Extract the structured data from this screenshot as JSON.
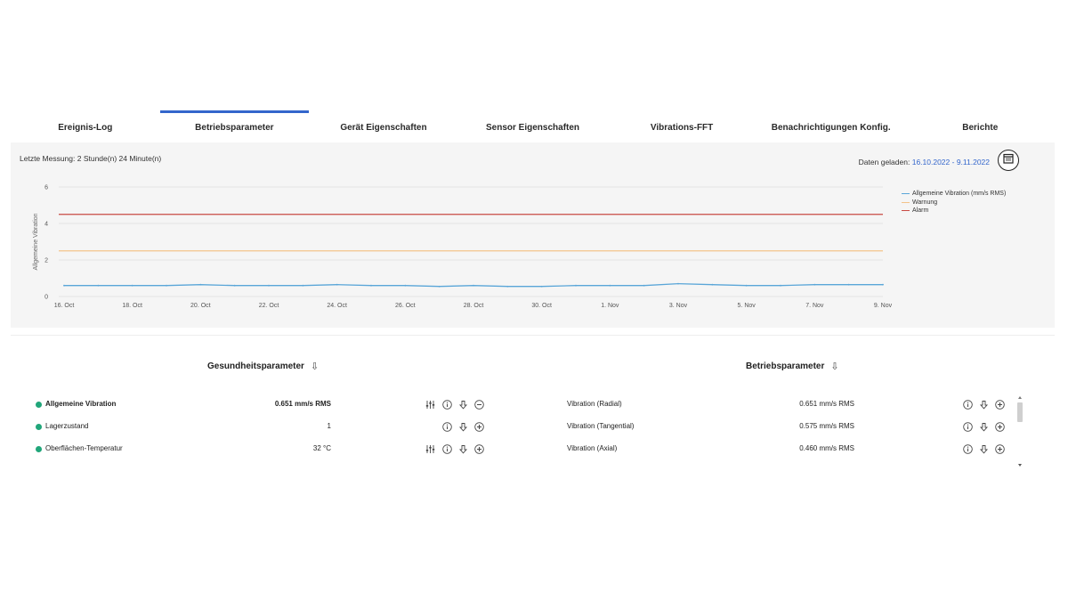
{
  "tabs": [
    {
      "label": "Ereignis-Log",
      "active": false
    },
    {
      "label": "Betriebsparameter",
      "active": true
    },
    {
      "label": "Gerät Eigenschaften",
      "active": false
    },
    {
      "label": "Sensor Eigenschaften",
      "active": false
    },
    {
      "label": "Vibrations-FFT",
      "active": false
    },
    {
      "label": "Benachrichtigungen Konfig.",
      "active": false
    },
    {
      "label": "Berichte",
      "active": false
    }
  ],
  "last_measurement": "Letzte Messung: 2 Stunde(n) 24 Minute(n)",
  "data_loaded": {
    "label": "Daten geladen:",
    "range": "16.10.2022 - 9.11.2022"
  },
  "colors": {
    "accent": "#3366cc",
    "status_ok": "#21a67a",
    "vibration": "#5aa6d8",
    "warning": "#f3c38a",
    "alarm": "#c94a43"
  },
  "chart_data": {
    "type": "line",
    "ylabel": "Allgemeine Vibration",
    "ylim": [
      0,
      6
    ],
    "yticks": [
      "0",
      "2",
      "4",
      "6"
    ],
    "x_tick_labels": [
      "16. Oct",
      "18. Oct",
      "20. Oct",
      "22. Oct",
      "24. Oct",
      "26. Oct",
      "28. Oct",
      "30. Oct",
      "1. Nov",
      "3. Nov",
      "5. Nov",
      "7. Nov",
      "9. Nov"
    ],
    "xlim": [
      "2022-10-16",
      "2022-11-09"
    ],
    "grid": true,
    "legend": "right",
    "series": [
      {
        "name": "Allgemeine Vibration (mm/s RMS)",
        "x": [
          "2022-10-16",
          "2022-10-17",
          "2022-10-18",
          "2022-10-19",
          "2022-10-20",
          "2022-10-21",
          "2022-10-22",
          "2022-10-23",
          "2022-10-24",
          "2022-10-25",
          "2022-10-26",
          "2022-10-27",
          "2022-10-28",
          "2022-10-29",
          "2022-10-30",
          "2022-10-31",
          "2022-11-01",
          "2022-11-02",
          "2022-11-03",
          "2022-11-04",
          "2022-11-05",
          "2022-11-06",
          "2022-11-07",
          "2022-11-08",
          "2022-11-09"
        ],
        "values": [
          0.6,
          0.6,
          0.6,
          0.6,
          0.65,
          0.6,
          0.6,
          0.6,
          0.65,
          0.6,
          0.6,
          0.55,
          0.6,
          0.55,
          0.55,
          0.6,
          0.6,
          0.6,
          0.7,
          0.65,
          0.6,
          0.6,
          0.65,
          0.65,
          0.65
        ]
      },
      {
        "name": "Warnung",
        "constant": 2.5
      },
      {
        "name": "Alarm",
        "constant": 4.5
      }
    ]
  },
  "health": {
    "title": "Gesundheitsparameter",
    "rows": [
      {
        "name": "Allgemeine Vibration",
        "value": "0.651 mm/s RMS",
        "bold": true
      },
      {
        "name": "Lagerzustand",
        "value": "1",
        "bold": false
      },
      {
        "name": "Oberflächen-Temperatur",
        "value": "32 °C",
        "bold": false
      }
    ]
  },
  "operating": {
    "title": "Betriebsparameter",
    "rows": [
      {
        "name": "Vibration (Radial)",
        "value": "0.651 mm/s RMS"
      },
      {
        "name": "Vibration (Tangential)",
        "value": "0.575 mm/s RMS"
      },
      {
        "name": "Vibration (Axial)",
        "value": "0.460 mm/s RMS"
      }
    ]
  },
  "icons": {
    "sliders": "sliders-icon",
    "info": "info-icon",
    "sort": "sort-arrow-icon",
    "add": "plus-circle-icon",
    "remove": "minus-circle-icon",
    "calendar": "calendar-icon"
  }
}
